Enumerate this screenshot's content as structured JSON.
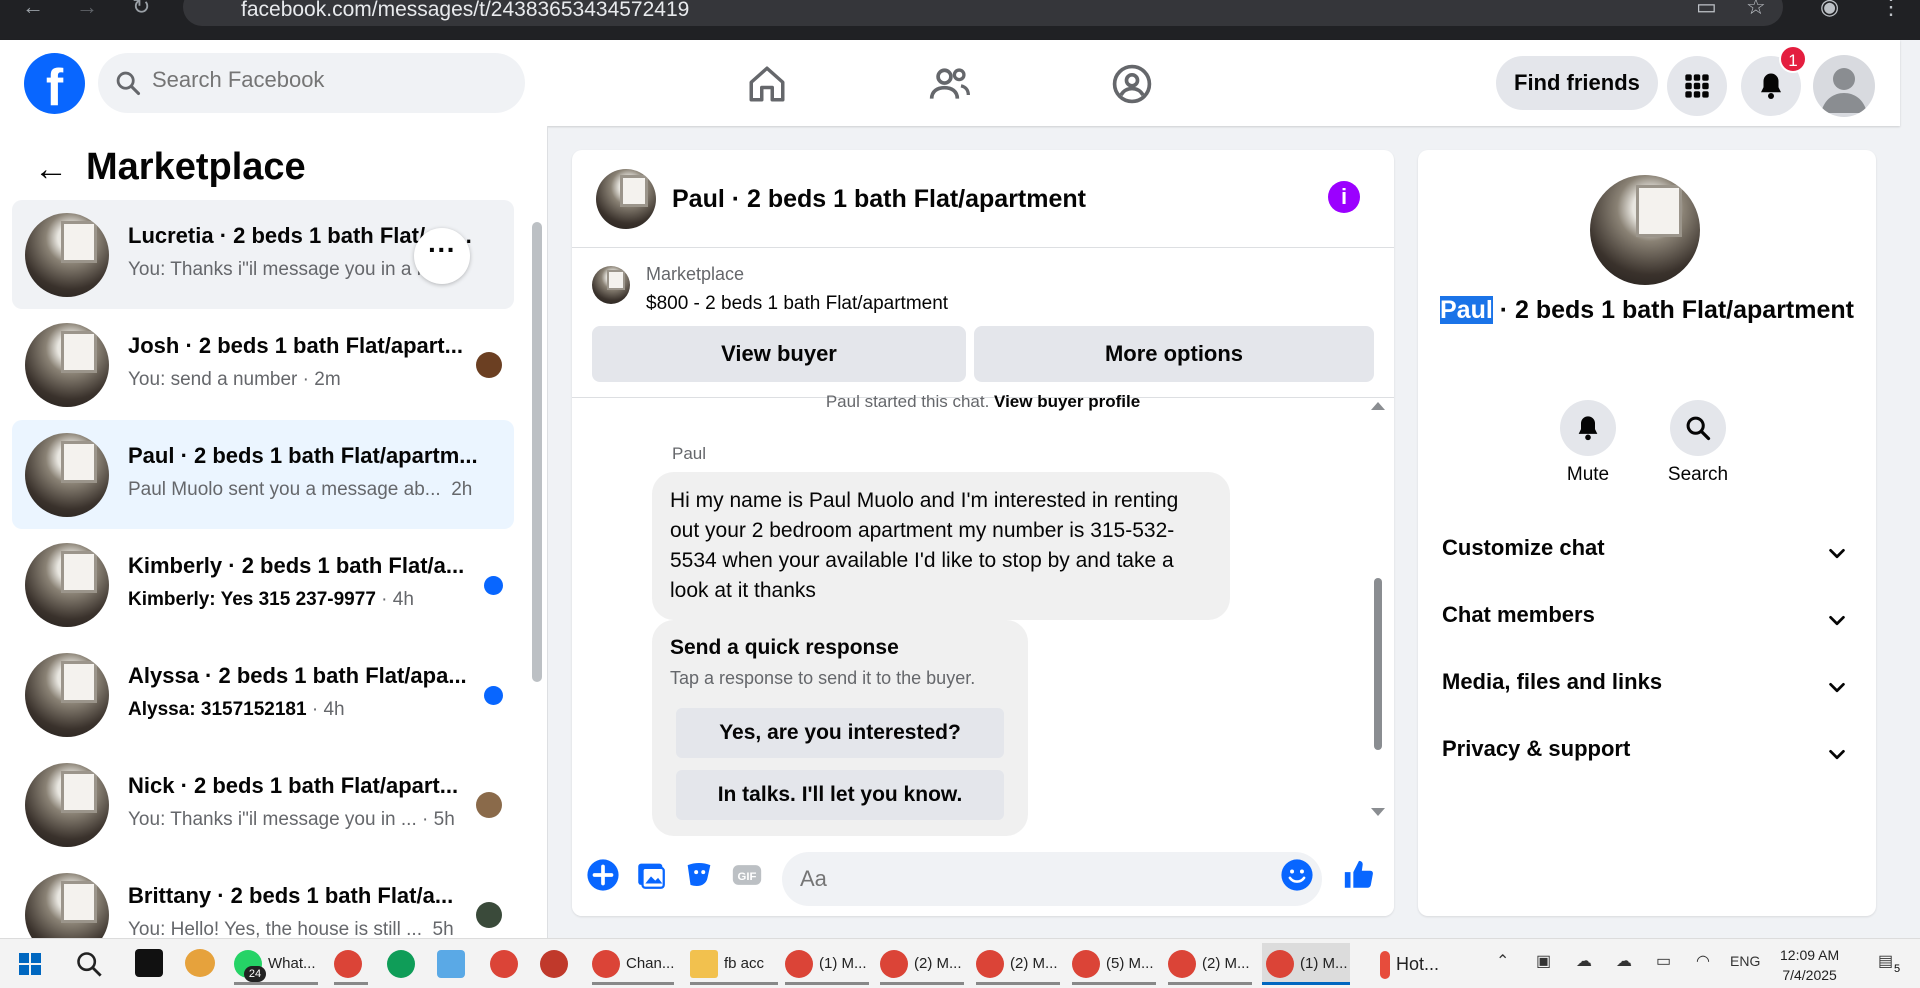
{
  "browser": {
    "url": "facebook.com/messages/t/24383653434572419"
  },
  "header": {
    "search_placeholder": "Search Facebook",
    "find_friends": "Find friends",
    "notification_count": "1"
  },
  "sidebar": {
    "title": "Marketplace",
    "threads": [
      {
        "name": "Lucretia · 2 beds 1 bath Flat/apartment",
        "snippet": "You: Thanks i\"il message you in a",
        "time": "m",
        "unread": false,
        "state": "hover"
      },
      {
        "name": "Josh · 2 beds 1 bath Flat/apart...",
        "snippet": "You: send a number",
        "time": "2m",
        "unread": false,
        "state": ""
      },
      {
        "name": "Paul · 2 beds 1 bath Flat/apartm...",
        "snippet": "Paul Muolo sent you a message ab...",
        "time": "2h",
        "unread": false,
        "state": "active"
      },
      {
        "name": "Kimberly · 2 beds 1 bath Flat/a...",
        "snippet": "Kimberly: Yes 315 237-9977",
        "time": "4h",
        "unread": true,
        "state": ""
      },
      {
        "name": "Alyssa · 2 beds 1 bath Flat/apa...",
        "snippet": "Alyssa: 3157152181",
        "time": "4h",
        "unread": true,
        "state": ""
      },
      {
        "name": "Nick · 2 beds 1 bath Flat/apart...",
        "snippet": "You: Thanks i\"il message you in ...",
        "time": "5h",
        "unread": false,
        "state": ""
      },
      {
        "name": "Brittany · 2 beds 1 bath Flat/a...",
        "snippet": "You: Hello! Yes, the house is still ...",
        "time": "5h",
        "unread": false,
        "state": ""
      }
    ]
  },
  "chat": {
    "title": "Paul · 2 beds 1 bath Flat/apartment",
    "listing_label": "Marketplace",
    "listing_price": "$800 - 2 beds 1 bath Flat/apartment",
    "view_buyer": "View buyer",
    "more_options": "More options",
    "system_text": "Paul started this chat.",
    "system_link": "View buyer profile",
    "sender": "Paul",
    "message": "Hi my name is Paul Muolo and I'm interested in renting out your 2 bedroom apartment my number is 315-532-5534 when your available I'd like to stop by and take a look at it thanks",
    "quick_title": "Send a quick response",
    "quick_subtitle": "Tap a response to send it to the buyer.",
    "quick_reply_1": "Yes, are you interested?",
    "quick_reply_2": "In talks. I'll let you know.",
    "input_placeholder": "Aa"
  },
  "right_panel": {
    "title_highlight": "Paul",
    "title_rest": " · 2 beds 1 bath Flat/apartment",
    "mute": "Mute",
    "search": "Search",
    "sections": [
      "Customize chat",
      "Chat members",
      "Media, files and links",
      "Privacy & support"
    ]
  },
  "taskbar": {
    "apps": [
      {
        "label": "What...",
        "badge": "24"
      },
      {
        "label": "Chan..."
      },
      {
        "label": "fb acc"
      },
      {
        "label": "(1) M..."
      },
      {
        "label": "(2) M..."
      },
      {
        "label": "(2) M..."
      },
      {
        "label": "(5) M..."
      },
      {
        "label": "(2) M..."
      },
      {
        "label": "(1) M..."
      },
      {
        "label": "Hot..."
      }
    ],
    "lang": "ENG",
    "time": "12:09 AM",
    "date": "7/4/2025",
    "notif_count": "5"
  },
  "colors": {
    "fb_blue": "#0866ff",
    "accent_purple": "#9b00ff",
    "badge_red": "#e41e3f"
  }
}
